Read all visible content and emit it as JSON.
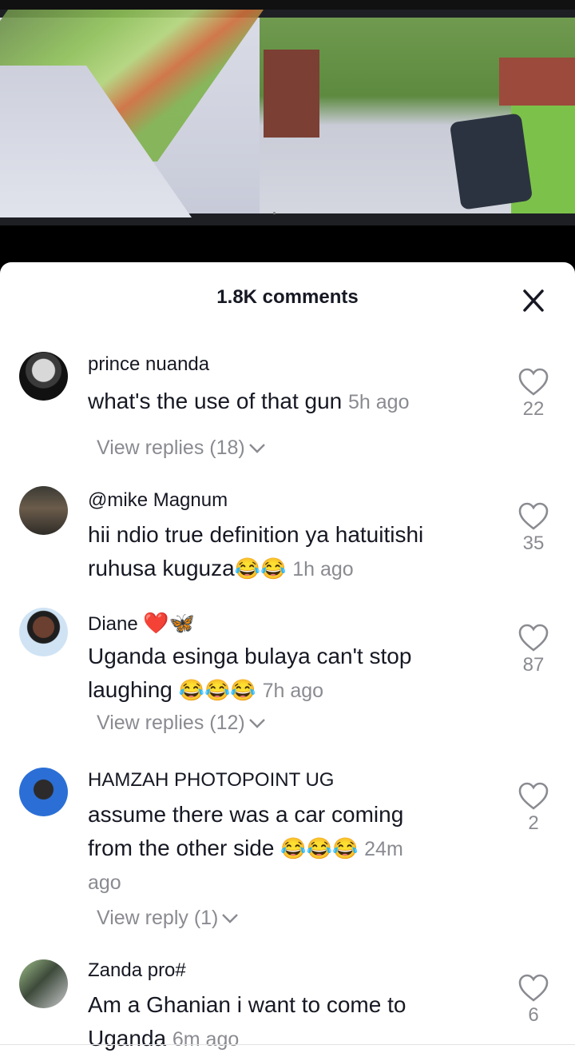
{
  "header": {
    "title": "1.8K comments"
  },
  "comments": [
    {
      "author": "prince nuanda",
      "text": "what's the use of that gun",
      "emoji": "",
      "time": "5h ago",
      "likes": "22",
      "replies": "View replies (18)"
    },
    {
      "author": "@mike Magnum",
      "text_line1": "hii ndio true definition ya hatuitishi",
      "text_line2": "ruhusa kuguza",
      "emoji": "😂😂",
      "time": "1h ago",
      "likes": "35"
    },
    {
      "author": "Diane",
      "author_emoji": "❤️🦋",
      "text_line1": "Uganda esinga bulaya can't stop",
      "text_line2": "laughing",
      "emoji": "😂😂😂",
      "time": "7h ago",
      "likes": "87",
      "replies": "View replies (12)"
    },
    {
      "author": "HAMZAH PHOTOPOINT UG",
      "text_line1": "assume there was a car coming",
      "text_line2": "from the other side",
      "emoji": "😂😂😂",
      "time_part1": "24m",
      "time_part2": "ago",
      "likes": "2",
      "replies": "View reply (1)"
    },
    {
      "author": "Zanda pro#",
      "text_line1": "Am a Ghanian i want to come to",
      "text_line2": "Uganda",
      "time": "6m ago",
      "likes": "6"
    }
  ],
  "icons": {
    "close": "close-icon",
    "like": "heart-outline-icon",
    "expand": "chevron-down-icon"
  }
}
